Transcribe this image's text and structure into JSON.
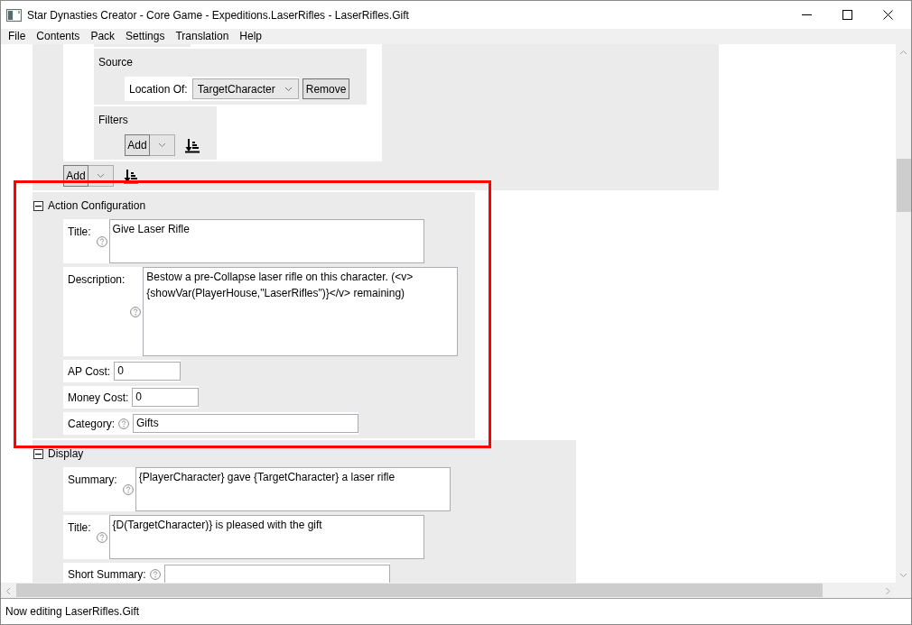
{
  "window": {
    "title": "Star Dynasties Creator - Core Game - Expeditions.LaserRifles - LaserRifles.Gift"
  },
  "menu": [
    "File",
    "Contents",
    "Pack",
    "Settings",
    "Translation",
    "Help"
  ],
  "editor": {
    "previous_section": {
      "source": {
        "title": "Source",
        "location_label": "Location Of:",
        "location_value": "TargetCharacter",
        "remove_label": "Remove"
      },
      "filters": {
        "title": "Filters",
        "add_label": "Add"
      },
      "add_label": "Add"
    },
    "sections": [
      {
        "title": "Action Configuration",
        "expanded": true,
        "highlighted": true,
        "fields": [
          {
            "kind": "text_area",
            "label": "Title:",
            "help": true,
            "value": "Give Laser Rifle"
          },
          {
            "kind": "large_text_area",
            "label": "Description:",
            "help": true,
            "value": "Bestow a pre-Collapse laser rifle on this character. (<v>{showVar(PlayerHouse,\"LaserRifles\")}</v> remaining)"
          },
          {
            "kind": "number",
            "label": "AP Cost:",
            "help": false,
            "value": "0"
          },
          {
            "kind": "number",
            "label": "Money Cost:",
            "help": false,
            "value": "0"
          },
          {
            "kind": "text",
            "label": "Category:",
            "help": true,
            "value": "Gifts"
          }
        ]
      },
      {
        "title": "Display",
        "expanded": true,
        "highlighted": false,
        "fields": [
          {
            "kind": "text_area",
            "label": "Summary:",
            "help": true,
            "value": "{PlayerCharacter} gave {TargetCharacter} a laser rifle"
          },
          {
            "kind": "text_area",
            "label": "Title:",
            "help": true,
            "value": "{D(TargetCharacter)} is pleased with the gift"
          },
          {
            "kind": "text",
            "label": "Short Summary:",
            "help": true
          }
        ]
      }
    ]
  },
  "status_bar": {
    "text": "Now editing LaserRifles.Gift"
  }
}
